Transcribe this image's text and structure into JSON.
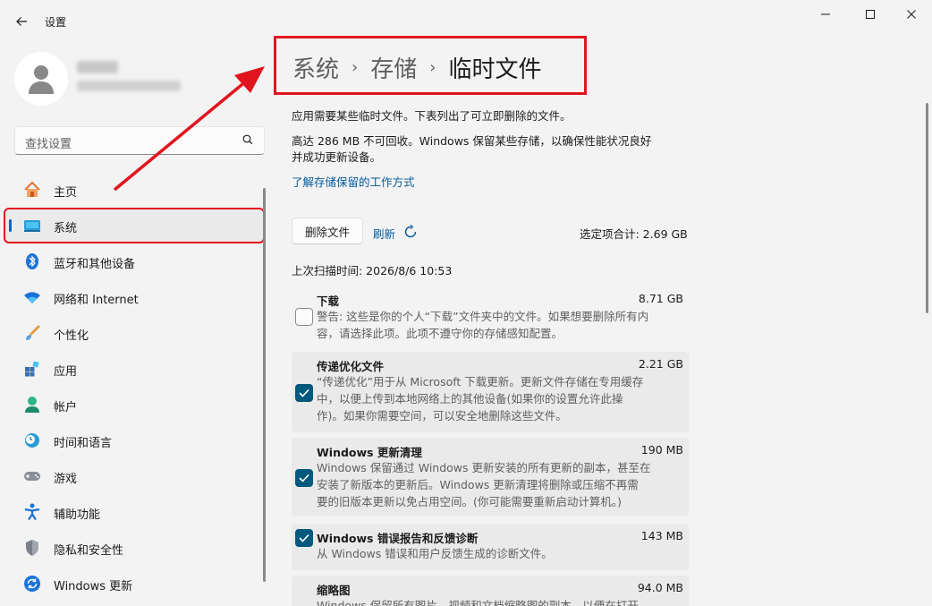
{
  "window": {
    "title": "设置"
  },
  "sidebar": {
    "search_placeholder": "查找设置",
    "items": [
      {
        "label": "主页",
        "icon": "home-icon"
      },
      {
        "label": "系统",
        "icon": "system-icon"
      },
      {
        "label": "蓝牙和其他设备",
        "icon": "bluetooth-icon"
      },
      {
        "label": "网络和 Internet",
        "icon": "wifi-icon"
      },
      {
        "label": "个性化",
        "icon": "brush-icon"
      },
      {
        "label": "应用",
        "icon": "apps-icon"
      },
      {
        "label": "帐户",
        "icon": "account-icon"
      },
      {
        "label": "时间和语言",
        "icon": "clock-globe-icon"
      },
      {
        "label": "游戏",
        "icon": "gamepad-icon"
      },
      {
        "label": "辅助功能",
        "icon": "accessibility-icon"
      },
      {
        "label": "隐私和安全性",
        "icon": "shield-icon"
      },
      {
        "label": "Windows 更新",
        "icon": "update-icon"
      }
    ],
    "active_index": 1
  },
  "breadcrumb": {
    "items": [
      "系统",
      "存储"
    ],
    "current": "临时文件",
    "separator": "›"
  },
  "content": {
    "intro": "应用需要某些临时文件。下表列出了可立即删除的文件。",
    "reserved_line1": "高达 286 MB 不可回收。Windows 保留某些存储，以确保性能状况良好",
    "reserved_line2": "并成功更新设备。",
    "learn_link": "了解存储保留的工作方式",
    "delete_button": "删除文件",
    "refresh_label": "刷新",
    "total_selected": "选定项合计: 2.69 GB",
    "last_scan": "上次扫描时间: 2026/8/6 10:53",
    "files": [
      {
        "name": "下载",
        "size": "8.71 GB",
        "checked": false,
        "desc_lines": [
          "警告: 这些是你的个人“下载”文件夹中的文件。如果想要删除所有内",
          "容，请选择此项。此项不遵守你的存储感知配置。"
        ]
      },
      {
        "name": "传递优化文件",
        "size": "2.21 GB",
        "checked": true,
        "desc_lines": [
          "“传递优化”用于从 Microsoft 下载更新。更新文件存储在专用缓存",
          "中，以便上传到本地网络上的其他设备(如果你的设置允许此操",
          "作)。如果你需要空间，可以安全地删除这些文件。"
        ]
      },
      {
        "name": "Windows 更新清理",
        "size": "190 MB",
        "checked": true,
        "desc_lines": [
          "Windows 保留通过 Windows 更新安装的所有更新的副本，甚至在",
          "安装了新版本的更新后。Windows 更新清理将删除或压缩不再需",
          "要的旧版本更新以免占用空间。(你可能需要重新启动计算机。)"
        ]
      },
      {
        "name": "Windows 错误报告和反馈诊断",
        "size": "143 MB",
        "checked": true,
        "desc_lines": [
          "从 Windows 错误和用户反馈生成的诊断文件。"
        ]
      },
      {
        "name": "缩略图",
        "size": "94.0 MB",
        "checked": true,
        "desc_lines": [
          "Windows 保留所有图片、视频和文档缩略图的副本，以便在打开"
        ]
      }
    ]
  },
  "colors": {
    "accent": "#005a7e",
    "link": "#005a9e",
    "highlight_red": "#e0141e"
  }
}
